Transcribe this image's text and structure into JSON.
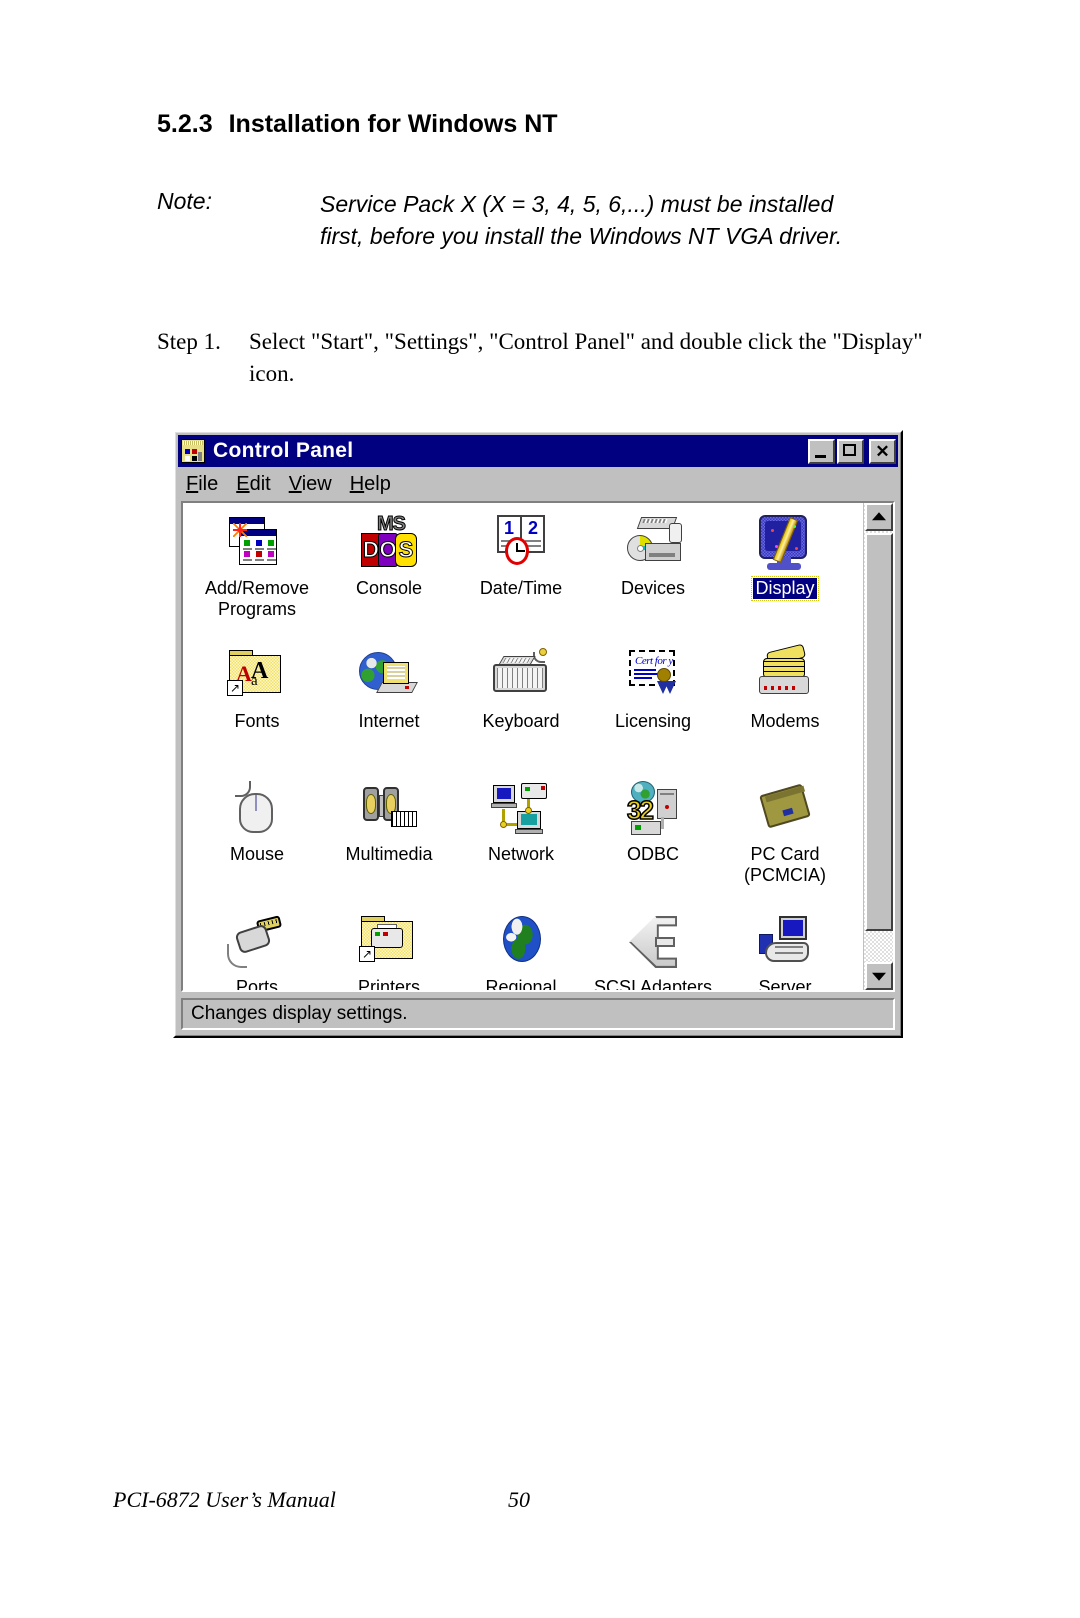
{
  "document": {
    "heading": {
      "number": "5.2.3",
      "title": "Installation for Windows NT"
    },
    "note": {
      "label": "Note:",
      "text": "Service Pack X (X = 3, 4, 5, 6,...) must be installed first, before you install the Windows NT VGA driver."
    },
    "step": {
      "label": "Step 1.",
      "text": "Select \"Start\", \"Settings\", \"Control Panel\" and double click the \"Display\" icon."
    },
    "footer": {
      "left": "PCI-6872 User’s Manual",
      "page": "50"
    }
  },
  "control_panel_window": {
    "title": "Control Panel",
    "title_icon": "control-panel-icon",
    "window_buttons": {
      "minimize": "–",
      "maximize": "□",
      "close": "✕"
    },
    "menu": [
      {
        "label": "File",
        "accel": "F"
      },
      {
        "label": "Edit",
        "accel": "E"
      },
      {
        "label": "View",
        "accel": "V"
      },
      {
        "label": "Help",
        "accel": "H"
      }
    ],
    "icons": [
      {
        "label": "Add/Remove\nPrograms",
        "art": "add-remove-programs",
        "selected": false
      },
      {
        "label": "Console",
        "art": "console",
        "selected": false
      },
      {
        "label": "Date/Time",
        "art": "date-time",
        "selected": false
      },
      {
        "label": "Devices",
        "art": "devices",
        "selected": false
      },
      {
        "label": "Display",
        "art": "display",
        "selected": true
      },
      {
        "label": "Fonts",
        "art": "fonts",
        "selected": false
      },
      {
        "label": "Internet",
        "art": "internet",
        "selected": false
      },
      {
        "label": "Keyboard",
        "art": "keyboard",
        "selected": false
      },
      {
        "label": "Licensing",
        "art": "licensing",
        "selected": false
      },
      {
        "label": "Modems",
        "art": "modems",
        "selected": false
      },
      {
        "label": "Mouse",
        "art": "mouse",
        "selected": false
      },
      {
        "label": "Multimedia",
        "art": "multimedia",
        "selected": false
      },
      {
        "label": "Network",
        "art": "network",
        "selected": false
      },
      {
        "label": "ODBC",
        "art": "odbc",
        "selected": false
      },
      {
        "label": "PC Card\n(PCMCIA)",
        "art": "pc-card",
        "selected": false
      },
      {
        "label": "Ports",
        "art": "ports",
        "selected": false
      },
      {
        "label": "Printers",
        "art": "printers",
        "selected": false
      },
      {
        "label": "Regional",
        "art": "regional",
        "selected": false
      },
      {
        "label": "SCSI Adapters",
        "art": "scsi-adapters",
        "selected": false
      },
      {
        "label": "Server",
        "art": "server",
        "selected": false
      }
    ],
    "scrollbar": {
      "up_arrow": "▲",
      "down_arrow": "▼"
    },
    "status_text": "Changes display settings."
  },
  "colors": {
    "titlebar": "#000080",
    "window_face": "#c0c0c0",
    "selection": "#000080",
    "focus_outline": "#d8c800",
    "client_bg": "#ffffff",
    "text": "#000000"
  }
}
